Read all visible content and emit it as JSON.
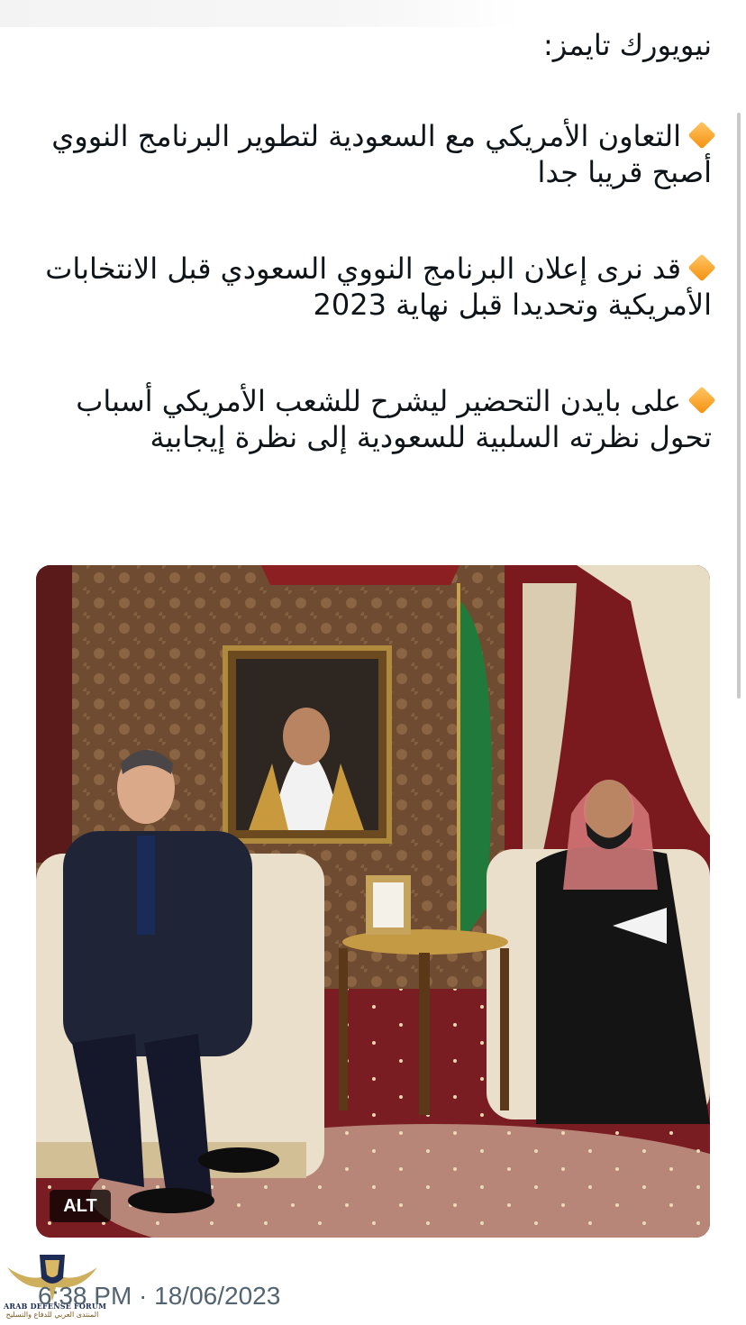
{
  "tweet": {
    "header": "نيويورك تايمز:",
    "bullets": [
      "التعاون الأمريكي مع السعودية لتطوير البرنامج النووي أصبح قريبا جدا",
      "قد نرى إعلان البرنامج النووي السعودي قبل الانتخابات الأمريكية وتحديدا قبل نهاية 2023",
      "على بايدن التحضير ليشرح للشعب الأمريكي أسباب تحول نظرته السلبية للسعودية إلى نظرة إيجابية"
    ],
    "bullet_icon": "orange-diamond-icon",
    "bullet_color": "#f4900c"
  },
  "media": {
    "alt_label": "ALT"
  },
  "meta": {
    "timestamp": "6:38 PM · 18/06/2023"
  },
  "watermark": {
    "name_en": "ARAB DEFENSE FORUM",
    "name_ar": "المنتدى العربي للدفاع والتسليح"
  },
  "colors": {
    "text": "#0f1419",
    "secondary": "#536471",
    "wallpaper": "#6b4a2f",
    "flag_green": "#1f7a3c"
  }
}
